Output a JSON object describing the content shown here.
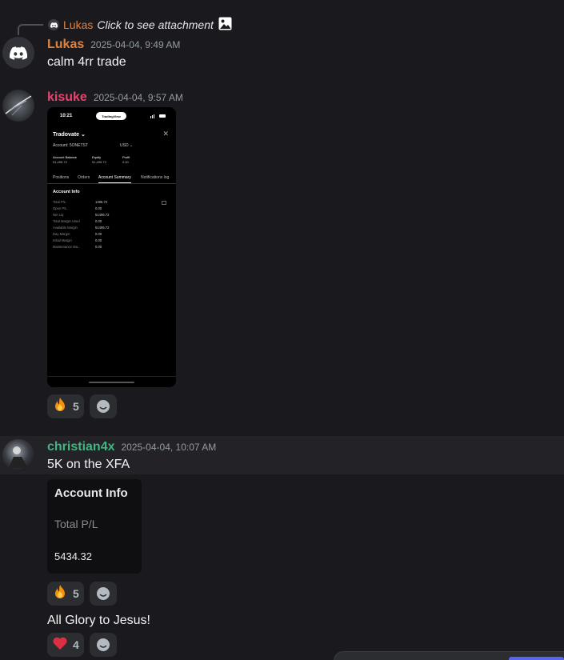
{
  "reply": {
    "author": "Lukas",
    "text": "Click to see attachment"
  },
  "messages": [
    {
      "author": "Lukas",
      "author_color": "#e0823d",
      "timestamp": "2025-04-04, 9:49 AM",
      "text": "calm 4rr trade"
    },
    {
      "author": "kisuke",
      "author_color": "#e6436f",
      "timestamp": "2025-04-04, 9:57 AM",
      "reactions": [
        {
          "emoji": "fire",
          "count": "5"
        }
      ]
    },
    {
      "author": "christian4x",
      "author_color": "#43b581",
      "timestamp": "2025-04-04, 10:07 AM",
      "text": "5K on the XFA",
      "reactions": [
        {
          "emoji": "fire",
          "count": "5"
        }
      ]
    },
    {
      "text": "All Glory to Jesus!",
      "reactions": [
        {
          "emoji": "red-heart",
          "count": "4"
        }
      ]
    }
  ],
  "phone_screenshot": {
    "status_time": "10:21",
    "pill_text": "TradingView",
    "title": "Tradovate",
    "account": "Account: 5ONETST",
    "currency": "USD",
    "stats": [
      {
        "label": "Account Balance",
        "value": "51,495.72"
      },
      {
        "label": "Equity",
        "value": "51,495.72"
      },
      {
        "label": "Profit",
        "value": "0.00"
      }
    ],
    "tabs": [
      "Positions",
      "Orders",
      "Account Summary",
      "Notifications log"
    ],
    "active_tab": "Account Summary",
    "section": "Account Info",
    "rows": [
      {
        "label": "Total P/L",
        "value": "1495.72"
      },
      {
        "label": "Open P/L",
        "value": "0.00"
      },
      {
        "label": "Net Liq",
        "value": "51496.72"
      },
      {
        "label": "Total Margin Used",
        "value": "0.00"
      },
      {
        "label": "Available Margin",
        "value": "51495.72"
      },
      {
        "label": "Day Margin",
        "value": "0.00"
      },
      {
        "label": "Initial Margin",
        "value": "0.00"
      },
      {
        "label": "Maintenance Ma...",
        "value": "0.00"
      }
    ]
  },
  "account_card": {
    "title": "Account Info",
    "label": "Total P/L",
    "value": "5434.32"
  },
  "colors": {
    "background": "#1a1a1e",
    "reaction_bg": "#2b2d31",
    "accent": "#5865f2"
  }
}
